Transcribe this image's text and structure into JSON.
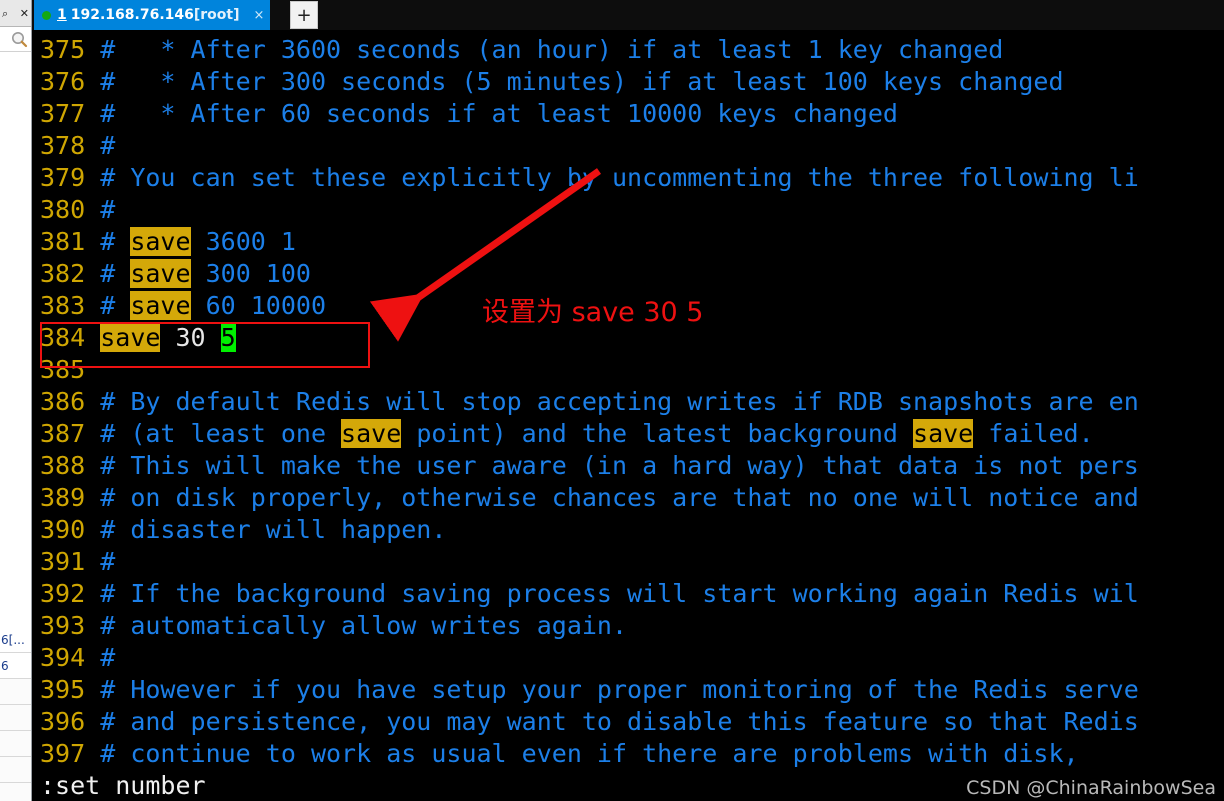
{
  "window": {
    "dock": {
      "pin_icon": "pin-icon",
      "close_icon": "close-icon",
      "search_icon": "search-icon",
      "rows": [
        "6[...",
        "6",
        "",
        "",
        "",
        "",
        ""
      ]
    }
  },
  "tabbar": {
    "dot_icon": "status-dot-icon",
    "index": "1",
    "title": "192.168.76.146",
    "user": "[root]",
    "close_icon": "×",
    "new_tab_icon": "+"
  },
  "terminal": {
    "lines": [
      {
        "num": "375",
        "segments": [
          {
            "t": "# ",
            "c": "hash"
          },
          {
            "t": "  * After 3600 seconds (an hour) if at least 1 key changed",
            "c": "cmt"
          }
        ]
      },
      {
        "num": "376",
        "segments": [
          {
            "t": "# ",
            "c": "hash"
          },
          {
            "t": "  * After 300 seconds (5 minutes) if at least 100 keys changed",
            "c": "cmt"
          }
        ]
      },
      {
        "num": "377",
        "segments": [
          {
            "t": "# ",
            "c": "hash"
          },
          {
            "t": "  * After 60 seconds if at least 10000 keys changed",
            "c": "cmt"
          }
        ]
      },
      {
        "num": "378",
        "segments": [
          {
            "t": "#",
            "c": "hash"
          }
        ]
      },
      {
        "num": "379",
        "segments": [
          {
            "t": "# ",
            "c": "hash"
          },
          {
            "t": "You can set these explicitly by uncommenting the three following li",
            "c": "cmt"
          }
        ]
      },
      {
        "num": "380",
        "segments": [
          {
            "t": "#",
            "c": "hash"
          }
        ]
      },
      {
        "num": "381",
        "segments": [
          {
            "t": "# ",
            "c": "hash"
          },
          {
            "t": "save",
            "c": "hl"
          },
          {
            "t": " 3600 1",
            "c": "cmt"
          }
        ]
      },
      {
        "num": "382",
        "segments": [
          {
            "t": "# ",
            "c": "hash"
          },
          {
            "t": "save",
            "c": "hl"
          },
          {
            "t": " 300 100",
            "c": "cmt"
          }
        ]
      },
      {
        "num": "383",
        "segments": [
          {
            "t": "# ",
            "c": "hash"
          },
          {
            "t": "save",
            "c": "hl"
          },
          {
            "t": " 60 10000",
            "c": "cmt"
          }
        ]
      },
      {
        "num": "384",
        "segments": [
          {
            "t": "save",
            "c": "hl"
          },
          {
            "t": " 30 ",
            "c": "plain"
          },
          {
            "t": "5",
            "c": "cur"
          }
        ]
      },
      {
        "num": "385",
        "segments": []
      },
      {
        "num": "386",
        "segments": [
          {
            "t": "# ",
            "c": "hash"
          },
          {
            "t": "By default Redis will stop accepting writes if RDB snapshots are en",
            "c": "cmt"
          }
        ]
      },
      {
        "num": "387",
        "segments": [
          {
            "t": "# ",
            "c": "hash"
          },
          {
            "t": "(at least one ",
            "c": "cmt"
          },
          {
            "t": "save",
            "c": "hl"
          },
          {
            "t": " point) and the latest background ",
            "c": "cmt"
          },
          {
            "t": "save",
            "c": "hl"
          },
          {
            "t": " failed.",
            "c": "cmt"
          }
        ]
      },
      {
        "num": "388",
        "segments": [
          {
            "t": "# ",
            "c": "hash"
          },
          {
            "t": "This will make the user aware (in a hard way) that data is not pers",
            "c": "cmt"
          }
        ]
      },
      {
        "num": "389",
        "segments": [
          {
            "t": "# ",
            "c": "hash"
          },
          {
            "t": "on disk properly, otherwise chances are that no one will notice and",
            "c": "cmt"
          }
        ]
      },
      {
        "num": "390",
        "segments": [
          {
            "t": "# ",
            "c": "hash"
          },
          {
            "t": "disaster will happen.",
            "c": "cmt"
          }
        ]
      },
      {
        "num": "391",
        "segments": [
          {
            "t": "#",
            "c": "hash"
          }
        ]
      },
      {
        "num": "392",
        "segments": [
          {
            "t": "# ",
            "c": "hash"
          },
          {
            "t": "If the background saving process will start working again Redis wil",
            "c": "cmt"
          }
        ]
      },
      {
        "num": "393",
        "segments": [
          {
            "t": "# ",
            "c": "hash"
          },
          {
            "t": "automatically allow writes again.",
            "c": "cmt"
          }
        ]
      },
      {
        "num": "394",
        "segments": [
          {
            "t": "#",
            "c": "hash"
          }
        ]
      },
      {
        "num": "395",
        "segments": [
          {
            "t": "# ",
            "c": "hash"
          },
          {
            "t": "However if you have setup your proper monitoring of the Redis serve",
            "c": "cmt"
          }
        ]
      },
      {
        "num": "396",
        "segments": [
          {
            "t": "# ",
            "c": "hash"
          },
          {
            "t": "and persistence, you may want to disable this feature so that Redis",
            "c": "cmt"
          }
        ]
      },
      {
        "num": "397",
        "segments": [
          {
            "t": "# ",
            "c": "hash"
          },
          {
            "t": "continue to work as usual even if there are problems with disk,",
            "c": "cmt"
          }
        ]
      }
    ]
  },
  "statusline": {
    "command": ":set number"
  },
  "watermark": {
    "text": "CSDN @ChinaRainbowSea"
  },
  "annotations": {
    "box_label": "save-line-highlight-box",
    "arrow_label": "red-arrow",
    "note": "设置为 save 30 5"
  },
  "colors": {
    "tab_blue": "#0084DC",
    "line_number": "#cfa602",
    "comment_blue": "#1c7fe8",
    "highlight_yellow": "#d4a809",
    "cursor_green": "#00f000",
    "annotation_red": "#ee1111",
    "terminal_bg": "#000000"
  }
}
